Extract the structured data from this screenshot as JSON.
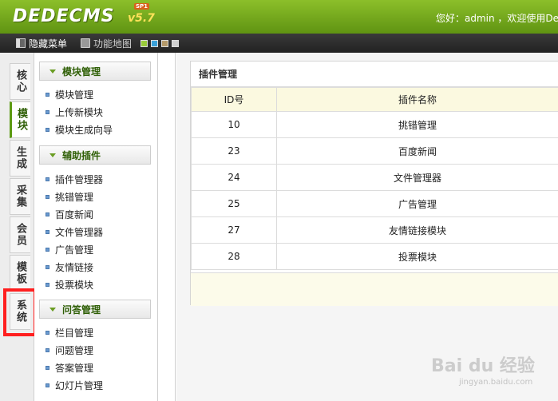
{
  "header": {
    "logo": "DEDECMS",
    "version": "v5.7",
    "badge": "SP1",
    "welcome": "您好：admin ，欢迎使用De"
  },
  "toolbar": {
    "hide_menu": "隐藏菜单",
    "function_map": "功能地图"
  },
  "tabs": [
    {
      "label": "核心"
    },
    {
      "label": "模块"
    },
    {
      "label": "生成"
    },
    {
      "label": "采集"
    },
    {
      "label": "会员"
    },
    {
      "label": "模板"
    },
    {
      "label": "系统"
    }
  ],
  "menu": {
    "sections": [
      {
        "title": "模块管理",
        "items": [
          "模块管理",
          "上传新模块",
          "模块生成向导"
        ]
      },
      {
        "title": "辅助插件",
        "items": [
          "插件管理器",
          "挑错管理",
          "百度新闻",
          "文件管理器",
          "广告管理",
          "友情链接",
          "投票模块"
        ]
      },
      {
        "title": "问答管理",
        "items": [
          "栏目管理",
          "问题管理",
          "答案管理",
          "幻灯片管理"
        ]
      }
    ]
  },
  "main": {
    "panel_title": "插件管理",
    "columns": [
      "ID号",
      "插件名称"
    ],
    "rows": [
      {
        "id": "10",
        "name": "挑错管理"
      },
      {
        "id": "23",
        "name": "百度新闻"
      },
      {
        "id": "24",
        "name": "文件管理器"
      },
      {
        "id": "25",
        "name": "广告管理"
      },
      {
        "id": "27",
        "name": "友情链接模块"
      },
      {
        "id": "28",
        "name": "投票模块"
      }
    ]
  },
  "watermark": {
    "text": "Bai du 经验",
    "sub": "jingyan.baidu.com"
  },
  "colors": {
    "header_green": "#6fa51a",
    "toolbar_dark": "#2c2c2c",
    "highlight_red": "#ff1f1f",
    "table_header_bg": "#fbf9e0"
  }
}
